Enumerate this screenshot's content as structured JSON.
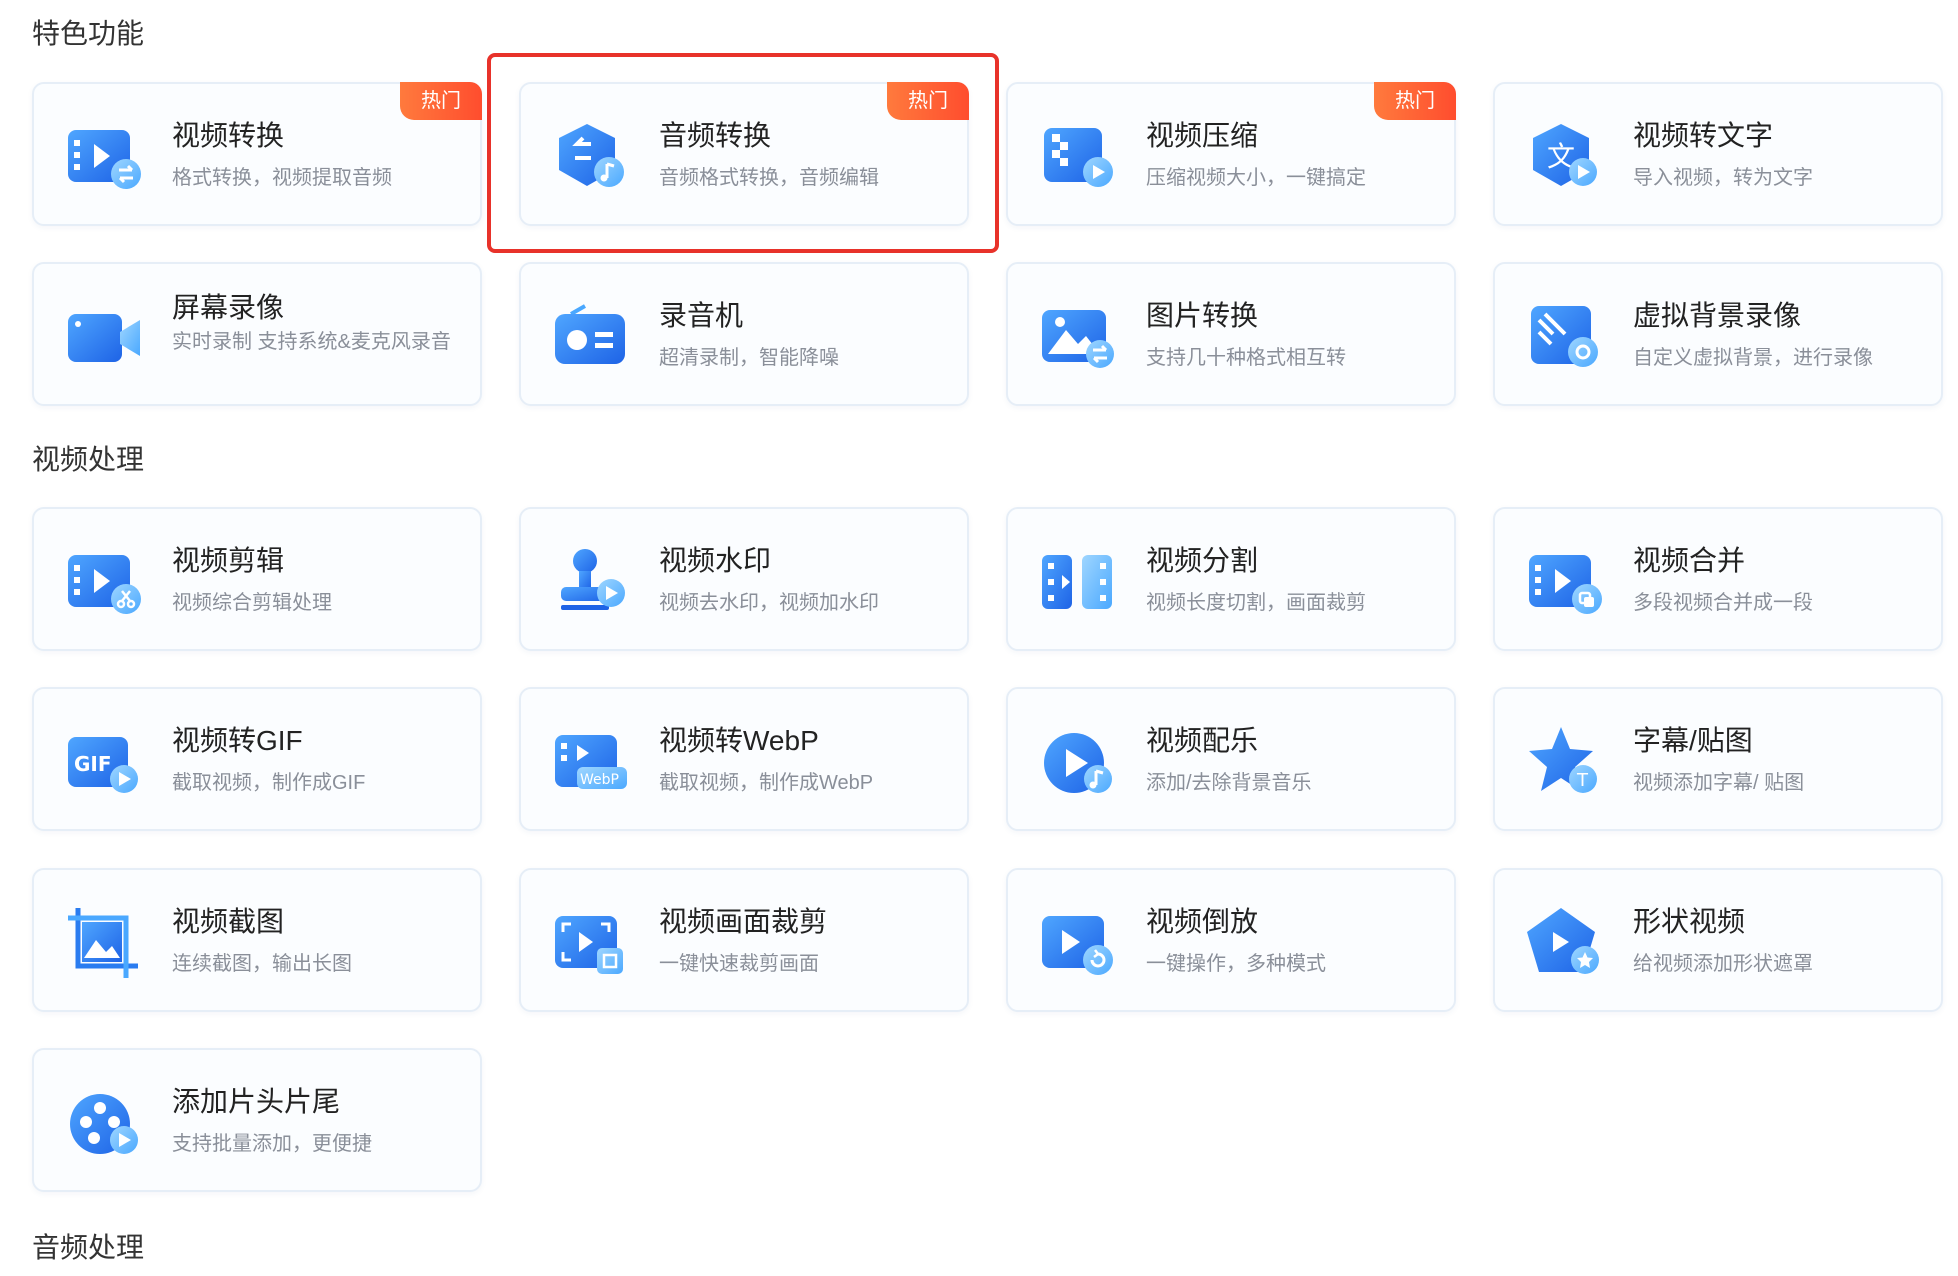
{
  "sections": {
    "featured": "特色功能",
    "video": "视频处理",
    "audio": "音频处理"
  },
  "badge_label": "热门",
  "featured_cards": [
    {
      "title": "视频转换",
      "desc": "格式转换，视频提取音频",
      "hot": true
    },
    {
      "title": "音频转换",
      "desc": "音频格式转换，音频编辑",
      "hot": true
    },
    {
      "title": "视频压缩",
      "desc": "压缩视频大小，一键搞定",
      "hot": true
    },
    {
      "title": "视频转文字",
      "desc": "导入视频，转为文字",
      "hot": false
    },
    {
      "title": "屏幕录像",
      "desc": "实时录制 支持系统&麦克风录音",
      "hot": false
    },
    {
      "title": "录音机",
      "desc": "超清录制，智能降噪",
      "hot": false
    },
    {
      "title": "图片转换",
      "desc": "支持几十种格式相互转",
      "hot": false
    },
    {
      "title": "虚拟背景录像",
      "desc": "自定义虚拟背景，进行录像",
      "hot": false
    }
  ],
  "video_cards": [
    {
      "title": "视频剪辑",
      "desc": "视频综合剪辑处理"
    },
    {
      "title": "视频水印",
      "desc": "视频去水印，视频加水印"
    },
    {
      "title": "视频分割",
      "desc": "视频长度切割，画面裁剪"
    },
    {
      "title": "视频合并",
      "desc": "多段视频合并成一段"
    },
    {
      "title": "视频转GIF",
      "desc": "截取视频，制作成GIF"
    },
    {
      "title": "视频转WebP",
      "desc": "截取视频，制作成WebP"
    },
    {
      "title": "视频配乐",
      "desc": "添加/去除背景音乐"
    },
    {
      "title": "字幕/贴图",
      "desc": "视频添加字幕/ 贴图"
    },
    {
      "title": "视频截图",
      "desc": "连续截图，输出长图"
    },
    {
      "title": "视频画面裁剪",
      "desc": "一键快速裁剪画面"
    },
    {
      "title": "视频倒放",
      "desc": "一键操作，多种模式"
    },
    {
      "title": "形状视频",
      "desc": "给视频添加形状遮罩"
    },
    {
      "title": "添加片头片尾",
      "desc": "支持批量添加，更便捷"
    }
  ],
  "icon_text": {
    "gif": "GIF",
    "webp": "WebP",
    "wen": "文",
    "t": "T"
  },
  "colors": {
    "accent_blue": "#2a7cf0",
    "light_blue": "#5bb4ff",
    "hot_badge": "#ff5a2e",
    "highlight": "#e8322a"
  }
}
